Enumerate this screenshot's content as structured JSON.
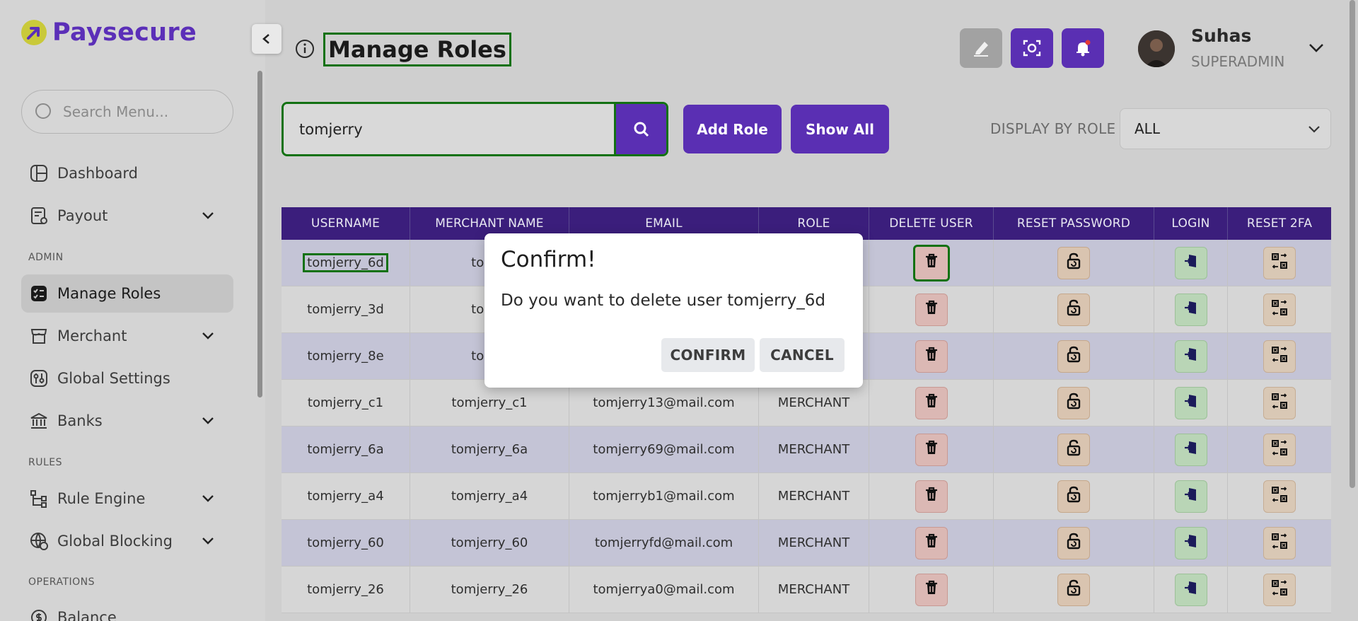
{
  "brand": {
    "name": "Paysecure"
  },
  "sidebar": {
    "search_placeholder": "Search Menu...",
    "items": [
      {
        "label": "Dashboard"
      },
      {
        "label": "Payout"
      },
      {
        "label": "Manage Roles"
      },
      {
        "label": "Merchant"
      },
      {
        "label": "Global Settings"
      },
      {
        "label": "Banks"
      },
      {
        "label": "Rule Engine"
      },
      {
        "label": "Global Blocking"
      },
      {
        "label": "Balance"
      }
    ],
    "sections": {
      "admin": "ADMIN",
      "rules": "RULES",
      "operations": "OPERATIONS"
    }
  },
  "header": {
    "title": "Manage Roles",
    "user": {
      "name": "Suhas",
      "role": "SUPERADMIN"
    }
  },
  "toolbar": {
    "search_value": "tomjerry",
    "add_role": "Add Role",
    "show_all": "Show All",
    "display_by_role_label": "DISPLAY BY ROLE",
    "display_by_role_value": "ALL"
  },
  "table": {
    "columns": [
      "USERNAME",
      "MERCHANT NAME",
      "EMAIL",
      "ROLE",
      "DELETE USER",
      "RESET PASSWORD",
      "LOGIN",
      "RESET 2FA"
    ],
    "rows": [
      {
        "username": "tomjerry_6d",
        "merchant": "tomje",
        "email": "",
        "role": ""
      },
      {
        "username": "tomjerry_3d",
        "merchant": "tomje",
        "email": "",
        "role": ""
      },
      {
        "username": "tomjerry_8e",
        "merchant": "tomje",
        "email": "",
        "role": ""
      },
      {
        "username": "tomjerry_c1",
        "merchant": "tomjerry_c1",
        "email": "tomjerry13@mail.com",
        "role": "MERCHANT"
      },
      {
        "username": "tomjerry_6a",
        "merchant": "tomjerry_6a",
        "email": "tomjerry69@mail.com",
        "role": "MERCHANT"
      },
      {
        "username": "tomjerry_a4",
        "merchant": "tomjerry_a4",
        "email": "tomjerryb1@mail.com",
        "role": "MERCHANT"
      },
      {
        "username": "tomjerry_60",
        "merchant": "tomjerry_60",
        "email": "tomjerryfd@mail.com",
        "role": "MERCHANT"
      },
      {
        "username": "tomjerry_26",
        "merchant": "tomjerry_26",
        "email": "tomjerrya0@mail.com",
        "role": "MERCHANT"
      }
    ]
  },
  "dialog": {
    "title": "Confirm!",
    "message": "Do you want to delete user tomjerry_6d",
    "confirm": "CONFIRM",
    "cancel": "CANCEL"
  },
  "colors": {
    "primary": "#5a2fb3",
    "table_header": "#3b1e7c",
    "highlight": "#127112"
  }
}
